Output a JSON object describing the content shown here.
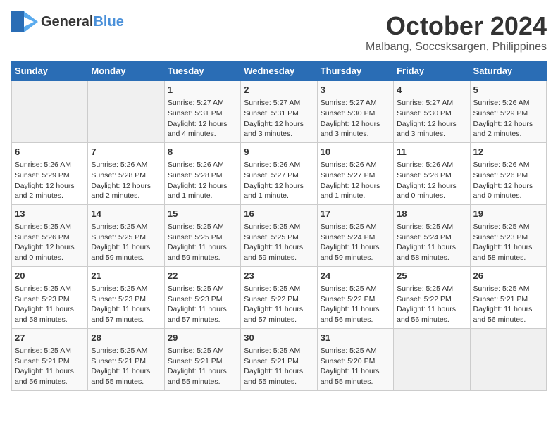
{
  "header": {
    "logo_text_general": "General",
    "logo_text_blue": "Blue",
    "month": "October 2024",
    "location": "Malbang, Soccsksargen, Philippines"
  },
  "days_of_week": [
    "Sunday",
    "Monday",
    "Tuesday",
    "Wednesday",
    "Thursday",
    "Friday",
    "Saturday"
  ],
  "weeks": [
    [
      {
        "day": "",
        "info": ""
      },
      {
        "day": "",
        "info": ""
      },
      {
        "day": "1",
        "info": "Sunrise: 5:27 AM\nSunset: 5:31 PM\nDaylight: 12 hours and 4 minutes."
      },
      {
        "day": "2",
        "info": "Sunrise: 5:27 AM\nSunset: 5:31 PM\nDaylight: 12 hours and 3 minutes."
      },
      {
        "day": "3",
        "info": "Sunrise: 5:27 AM\nSunset: 5:30 PM\nDaylight: 12 hours and 3 minutes."
      },
      {
        "day": "4",
        "info": "Sunrise: 5:27 AM\nSunset: 5:30 PM\nDaylight: 12 hours and 3 minutes."
      },
      {
        "day": "5",
        "info": "Sunrise: 5:26 AM\nSunset: 5:29 PM\nDaylight: 12 hours and 2 minutes."
      }
    ],
    [
      {
        "day": "6",
        "info": "Sunrise: 5:26 AM\nSunset: 5:29 PM\nDaylight: 12 hours and 2 minutes."
      },
      {
        "day": "7",
        "info": "Sunrise: 5:26 AM\nSunset: 5:28 PM\nDaylight: 12 hours and 2 minutes."
      },
      {
        "day": "8",
        "info": "Sunrise: 5:26 AM\nSunset: 5:28 PM\nDaylight: 12 hours and 1 minute."
      },
      {
        "day": "9",
        "info": "Sunrise: 5:26 AM\nSunset: 5:27 PM\nDaylight: 12 hours and 1 minute."
      },
      {
        "day": "10",
        "info": "Sunrise: 5:26 AM\nSunset: 5:27 PM\nDaylight: 12 hours and 1 minute."
      },
      {
        "day": "11",
        "info": "Sunrise: 5:26 AM\nSunset: 5:26 PM\nDaylight: 12 hours and 0 minutes."
      },
      {
        "day": "12",
        "info": "Sunrise: 5:26 AM\nSunset: 5:26 PM\nDaylight: 12 hours and 0 minutes."
      }
    ],
    [
      {
        "day": "13",
        "info": "Sunrise: 5:25 AM\nSunset: 5:26 PM\nDaylight: 12 hours and 0 minutes."
      },
      {
        "day": "14",
        "info": "Sunrise: 5:25 AM\nSunset: 5:25 PM\nDaylight: 11 hours and 59 minutes."
      },
      {
        "day": "15",
        "info": "Sunrise: 5:25 AM\nSunset: 5:25 PM\nDaylight: 11 hours and 59 minutes."
      },
      {
        "day": "16",
        "info": "Sunrise: 5:25 AM\nSunset: 5:25 PM\nDaylight: 11 hours and 59 minutes."
      },
      {
        "day": "17",
        "info": "Sunrise: 5:25 AM\nSunset: 5:24 PM\nDaylight: 11 hours and 59 minutes."
      },
      {
        "day": "18",
        "info": "Sunrise: 5:25 AM\nSunset: 5:24 PM\nDaylight: 11 hours and 58 minutes."
      },
      {
        "day": "19",
        "info": "Sunrise: 5:25 AM\nSunset: 5:23 PM\nDaylight: 11 hours and 58 minutes."
      }
    ],
    [
      {
        "day": "20",
        "info": "Sunrise: 5:25 AM\nSunset: 5:23 PM\nDaylight: 11 hours and 58 minutes."
      },
      {
        "day": "21",
        "info": "Sunrise: 5:25 AM\nSunset: 5:23 PM\nDaylight: 11 hours and 57 minutes."
      },
      {
        "day": "22",
        "info": "Sunrise: 5:25 AM\nSunset: 5:23 PM\nDaylight: 11 hours and 57 minutes."
      },
      {
        "day": "23",
        "info": "Sunrise: 5:25 AM\nSunset: 5:22 PM\nDaylight: 11 hours and 57 minutes."
      },
      {
        "day": "24",
        "info": "Sunrise: 5:25 AM\nSunset: 5:22 PM\nDaylight: 11 hours and 56 minutes."
      },
      {
        "day": "25",
        "info": "Sunrise: 5:25 AM\nSunset: 5:22 PM\nDaylight: 11 hours and 56 minutes."
      },
      {
        "day": "26",
        "info": "Sunrise: 5:25 AM\nSunset: 5:21 PM\nDaylight: 11 hours and 56 minutes."
      }
    ],
    [
      {
        "day": "27",
        "info": "Sunrise: 5:25 AM\nSunset: 5:21 PM\nDaylight: 11 hours and 56 minutes."
      },
      {
        "day": "28",
        "info": "Sunrise: 5:25 AM\nSunset: 5:21 PM\nDaylight: 11 hours and 55 minutes."
      },
      {
        "day": "29",
        "info": "Sunrise: 5:25 AM\nSunset: 5:21 PM\nDaylight: 11 hours and 55 minutes."
      },
      {
        "day": "30",
        "info": "Sunrise: 5:25 AM\nSunset: 5:21 PM\nDaylight: 11 hours and 55 minutes."
      },
      {
        "day": "31",
        "info": "Sunrise: 5:25 AM\nSunset: 5:20 PM\nDaylight: 11 hours and 55 minutes."
      },
      {
        "day": "",
        "info": ""
      },
      {
        "day": "",
        "info": ""
      }
    ]
  ]
}
